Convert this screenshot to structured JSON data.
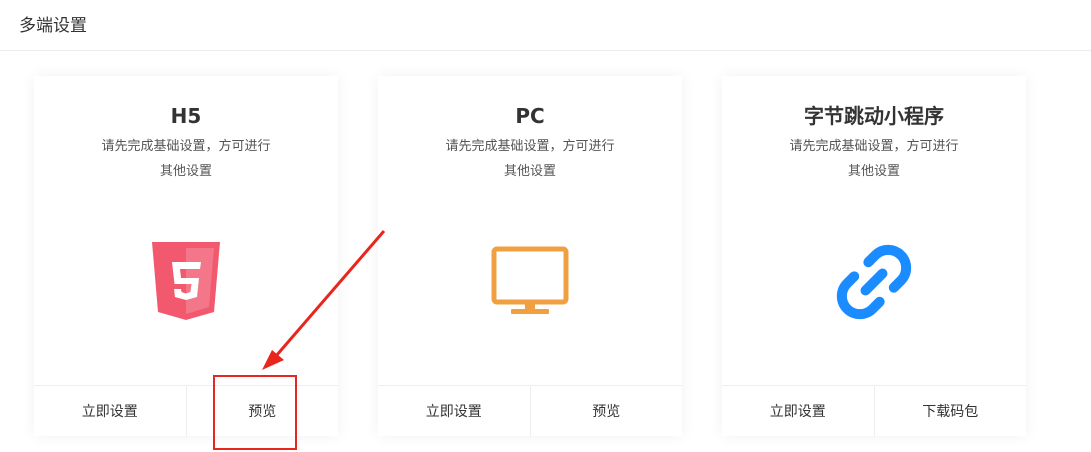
{
  "header": {
    "title": "多端设置"
  },
  "cards": [
    {
      "title": "H5",
      "desc_line1": "请先完成基础设置，方可进行",
      "desc_line2": "其他设置",
      "icon": "html5-icon",
      "icon_color": "#f2596e",
      "actions": [
        "立即设置",
        "预览"
      ]
    },
    {
      "title": "PC",
      "desc_line1": "请先完成基础设置，方可进行",
      "desc_line2": "其他设置",
      "icon": "monitor-icon",
      "icon_color": "#f0a040",
      "actions": [
        "立即设置",
        "预览"
      ]
    },
    {
      "title": "字节跳动小程序",
      "desc_line1": "请先完成基础设置，方可进行",
      "desc_line2": "其他设置",
      "icon": "link-icon",
      "icon_color": "#1a8cff",
      "actions": [
        "立即设置",
        "下载码包"
      ]
    }
  ],
  "annotation": {
    "color": "#e8261e"
  }
}
